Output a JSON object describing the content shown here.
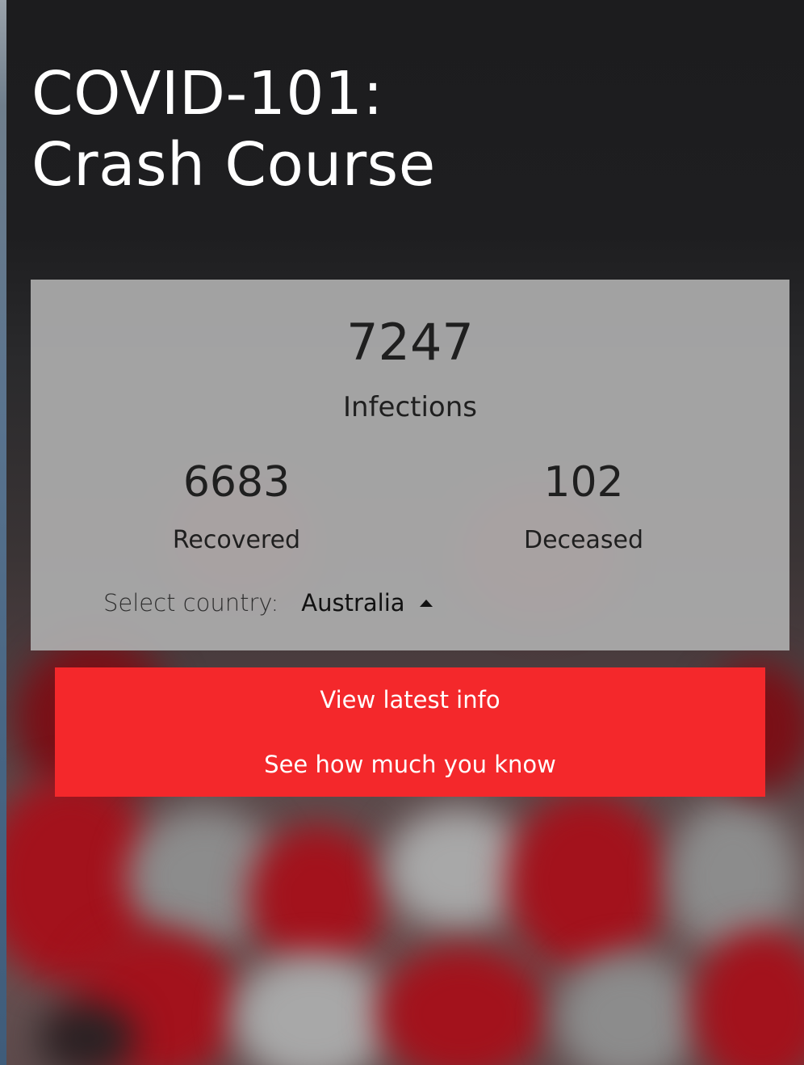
{
  "page": {
    "title_line1": "COVID-101:",
    "title_line2": "Crash Course"
  },
  "stats": {
    "infections": {
      "value": "7247",
      "label": "Infections"
    },
    "recovered": {
      "value": "6683",
      "label": "Recovered"
    },
    "deceased": {
      "value": "102",
      "label": "Deceased"
    }
  },
  "country_selector": {
    "label": "Select country:",
    "selected": "Australia",
    "icon": "caret-up-icon"
  },
  "actions": {
    "view_latest": "View latest info",
    "quiz": "See how much you know"
  },
  "colors": {
    "background": "#1b1b1d",
    "card": "#acacac",
    "accent": "#f4282b",
    "text_light": "#ffffff",
    "text_dark": "#1f1f1f"
  }
}
